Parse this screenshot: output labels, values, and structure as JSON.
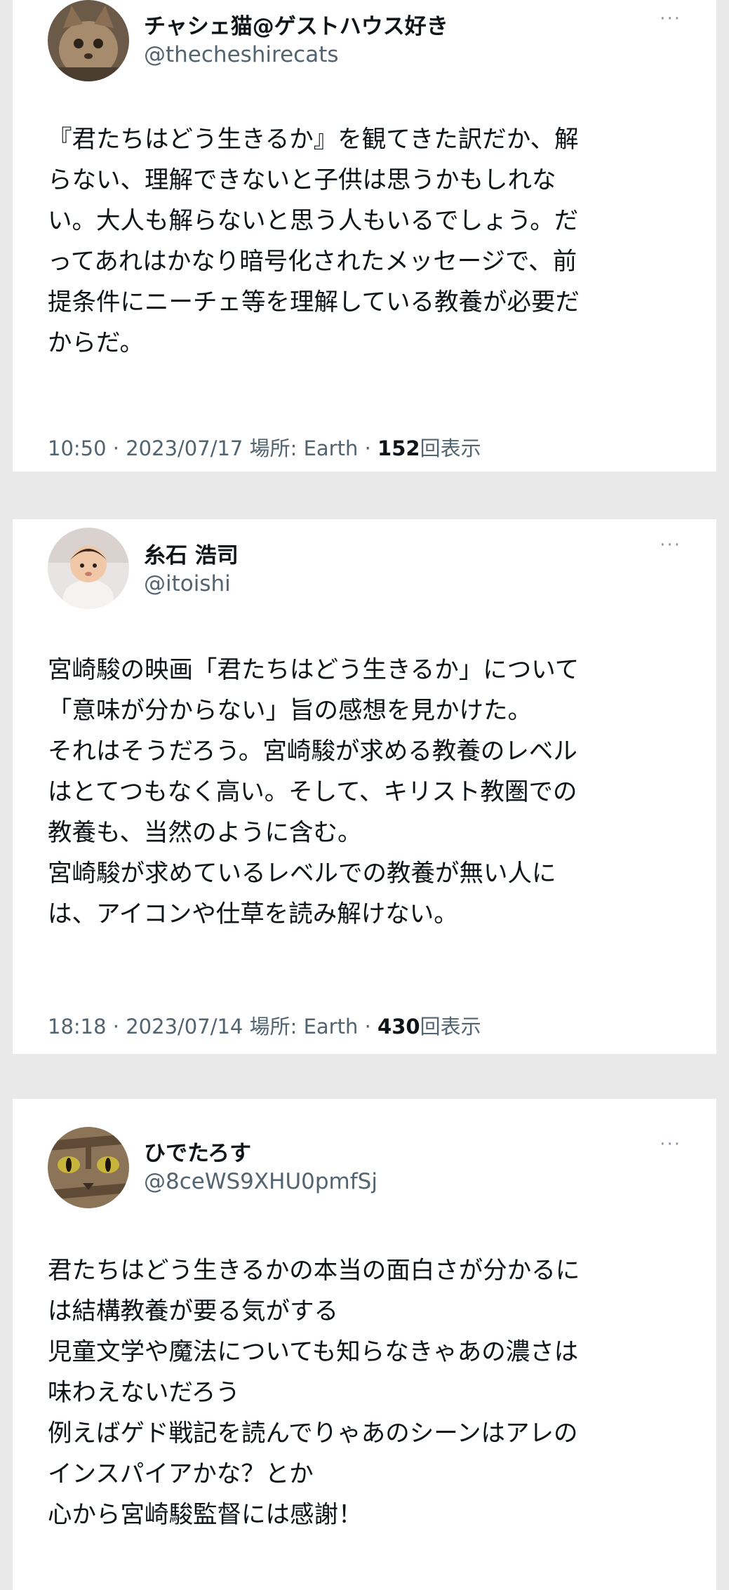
{
  "tweets": [
    {
      "name": "チャシェ猫@ゲストハウス好き",
      "handle": "@thecheshirecats",
      "more": "···",
      "lines": [
        "『君たちはどう生きるか』を観てきた訳だか、解",
        "らない、理解できないと子供は思うかもしれな",
        "い。大人も解らないと思う人もいるでしょう。だ",
        "ってあれはかなり暗号化されたメッセージで、前",
        "提条件にニーチェ等を理解している教養が必要だ",
        "からだ。"
      ],
      "meta_prefix": "10:50 · 2023/07/17 場所: Earth · ",
      "views": "152",
      "views_label": "回表示",
      "avatar": "cat-icon"
    },
    {
      "name": "糸石 浩司",
      "handle": "@itoishi",
      "more": "···",
      "lines": [
        "宮崎駿の映画「君たちはどう生きるか」について",
        "「意味が分からない」旨の感想を見かけた。",
        "それはそうだろう。宮崎駿が求める教養のレベル",
        "はとてつもなく高い。そして、キリスト教圏での",
        "教養も、当然のように含む。",
        "宮崎駿が求めているレベルでの教養が無い人に",
        "は、アイコンや仕草を読み解けない。"
      ],
      "meta_prefix": "18:18 · 2023/07/14 場所: Earth · ",
      "views": "430",
      "views_label": "回表示",
      "avatar": "baby-icon"
    },
    {
      "name": "ひでたろす",
      "handle": "@8ceWS9XHU0pmfSj",
      "more": "···",
      "lines": [
        "君たちはどう生きるかの本当の面白さが分かるに",
        "は結構教養が要る気がする",
        "児童文学や魔法についても知らなきゃあの濃さは",
        "味わえないだろう",
        "例えばゲド戦記を読んでりゃあのシーンはアレの",
        "インスパイアかな？とか",
        "心から宮崎駿監督には感謝！"
      ],
      "avatar": "tabby-cat-icon"
    }
  ]
}
